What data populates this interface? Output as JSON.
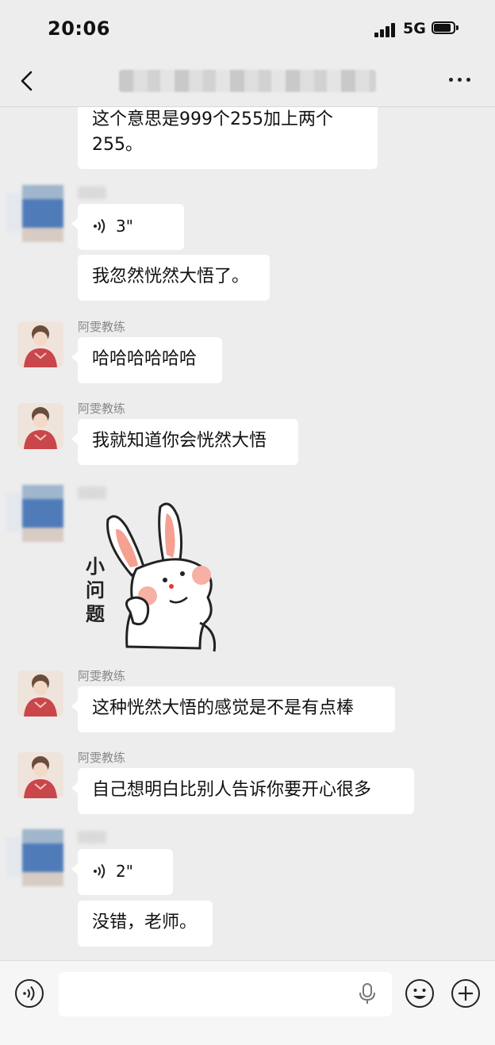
{
  "status_bar": {
    "time": "20:06",
    "network": "5G"
  },
  "header": {
    "title": "",
    "back_icon": "chevron-left-icon",
    "more_icon": "more-dots-icon"
  },
  "messages": [
    {
      "sender": "self",
      "type": "text",
      "text": "这个意思是999个255加上两个255。"
    },
    {
      "sender": "other-blurred",
      "type": "voice",
      "duration": "3\""
    },
    {
      "sender": "other-blurred",
      "type": "text",
      "text": "我忽然恍然大悟了。"
    },
    {
      "sender": "阿雯教练",
      "type": "text",
      "text": "哈哈哈哈哈哈"
    },
    {
      "sender": "阿雯教练",
      "type": "text",
      "text": "我就知道你会恍然大悟"
    },
    {
      "sender": "other-blurred",
      "type": "sticker",
      "sticker_text": "小问题"
    },
    {
      "sender": "阿雯教练",
      "type": "text",
      "text": "这种恍然大悟的感觉是不是有点棒"
    },
    {
      "sender": "阿雯教练",
      "type": "text",
      "text": "自己想明白比别人告诉你要开心很多"
    },
    {
      "sender": "other-blurred",
      "type": "voice",
      "duration": "2\""
    },
    {
      "sender": "other-blurred",
      "type": "text",
      "text": "没错，老师。"
    }
  ],
  "input_bar": {
    "placeholder": "",
    "voice_icon": "voice-input-icon",
    "mic_icon": "microphone-icon",
    "emoji_icon": "emoji-icon",
    "plus_icon": "plus-icon"
  },
  "colors": {
    "background": "#ededed",
    "bubble": "#ffffff",
    "name_text": "#888888"
  }
}
